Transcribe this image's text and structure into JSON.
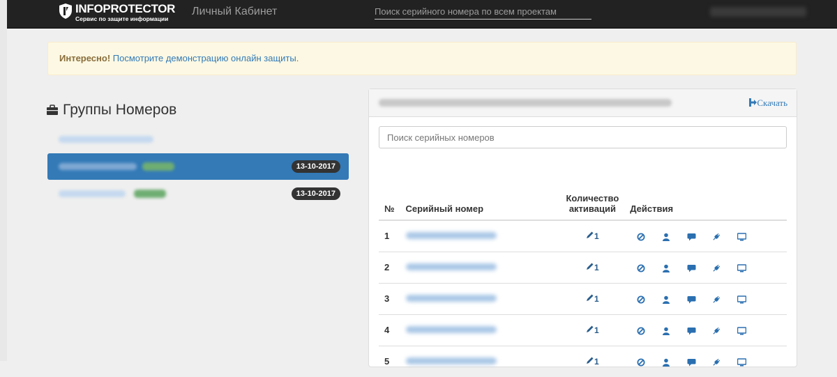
{
  "navbar": {
    "brand": "INFOPROTECTOR",
    "tagline": "Сервис по защите информации",
    "title": "Личный Кабинет",
    "search_placeholder": "Поиск серийного номера по всем проектам"
  },
  "alert": {
    "strong": "Интересно!",
    "link": "Посмотрите демонстрацию онлайн защиты",
    "end": "."
  },
  "groups": {
    "title": "Группы Номеров",
    "items": [
      {
        "date": "",
        "active": false
      },
      {
        "date": "13-10-2017",
        "active": true
      },
      {
        "date": "13-10-2017",
        "active": false
      }
    ]
  },
  "panel": {
    "download_label": "Скачать",
    "search_placeholder": "Поиск серийных номеров",
    "columns": {
      "num": "№",
      "serial": "Серийный номер",
      "count_line1": "Количество",
      "count_line2": "активаций",
      "actions": "Действия"
    },
    "rows": [
      {
        "num": "1",
        "count": "1"
      },
      {
        "num": "2",
        "count": "1"
      },
      {
        "num": "3",
        "count": "1"
      },
      {
        "num": "4",
        "count": "1"
      },
      {
        "num": "5",
        "count": "1"
      }
    ]
  },
  "colors": {
    "navbar": "#222222",
    "link": "#337ab7",
    "active_group": "#337ab7",
    "alert_bg": "#fcf8e3"
  },
  "icons": [
    "ban-icon",
    "user-icon",
    "comment-icon",
    "plug-icon",
    "monitor-icon",
    "pencil-icon",
    "briefcase-icon",
    "download-icon"
  ]
}
